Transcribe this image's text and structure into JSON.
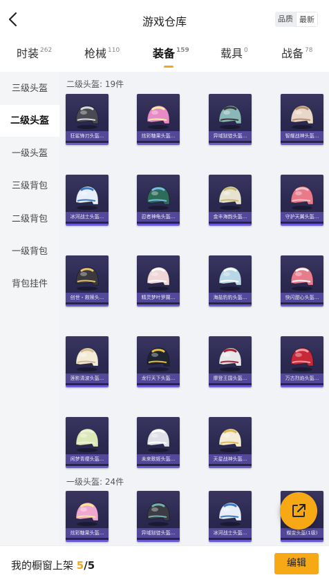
{
  "header": {
    "title": "游戏仓库",
    "sort": [
      "品质",
      "最新"
    ],
    "active_sort": 1
  },
  "tabs": [
    {
      "label": "时装",
      "count": "262"
    },
    {
      "label": "枪械",
      "count": "110"
    },
    {
      "label": "装备",
      "count": "159",
      "active": true
    },
    {
      "label": "载具",
      "count": "0"
    },
    {
      "label": "战备",
      "count": "78"
    }
  ],
  "sidebar": {
    "items": [
      "三级头盔",
      "二级头盔",
      "一级头盔",
      "三级背包",
      "二级背包",
      "一级背包",
      "背包挂件"
    ],
    "active": 1
  },
  "sections": [
    {
      "title": "二级头盔: 19件",
      "items": [
        {
          "name": "狂鲨锋刃头盔...",
          "color": "#4a4a52",
          "accent": "#d8d8e0"
        },
        {
          "name": "炫彩糖果头盔...",
          "color": "#e889c8",
          "accent": "#f4f0a0"
        },
        {
          "name": "异域狱徒头盔...",
          "color": "#8ab8b8",
          "accent": "#3a3a3a"
        },
        {
          "name": "智耀战神头盔...",
          "color": "#e9d7c9",
          "accent": "#b89070"
        },
        {
          "name": "冰河战士头盔...",
          "color": "#e8eef8",
          "accent": "#3a78c8"
        },
        {
          "name": "忍者神龟头盔...",
          "color": "#2e6b58",
          "accent": "#7ab8e8"
        },
        {
          "name": "金丰海韵头盔...",
          "color": "#e6e4d0",
          "accent": "#c8b870"
        },
        {
          "name": "守护天翼头盔...",
          "color": "#e87a8a",
          "accent": "#f0c0c8"
        },
        {
          "name": "创世・救赎头...",
          "color": "#3a3a3e",
          "accent": "#e8c070"
        },
        {
          "name": "精灵梦叶罗蘭...",
          "color": "#f0d6d8",
          "accent": "#ffffff"
        },
        {
          "name": "海盐豹豹头盔...",
          "color": "#b8d8e8",
          "accent": "#ffffff"
        },
        {
          "name": "快闪甜心头盔...",
          "color": "#e67c8c",
          "accent": "#ffffff"
        },
        {
          "name": "莲影清波头盔...",
          "color": "#f2ebd8",
          "accent": "#d8b890"
        },
        {
          "name": "龙行天下头盔...",
          "color": "#1e2430",
          "accent": "#e8c040"
        },
        {
          "name": "摩登王国头盔...",
          "color": "#e8e8ec",
          "accent": "#a82030"
        },
        {
          "name": "万古烈焰头盔...",
          "color": "#c82838",
          "accent": "#f0a0a0"
        },
        {
          "name": "闲梦青缨头盔...",
          "color": "#dce8b8",
          "accent": "#f0f0d8"
        },
        {
          "name": "未来歌姬头盔...",
          "color": "#e0e0e8",
          "accent": "#ffffff"
        },
        {
          "name": "天星战神头盔...",
          "color": "#f2ecd8",
          "accent": "#e0b850"
        }
      ]
    },
    {
      "title": "一级头盔: 24件",
      "items": [
        {
          "name": "炫彩糖果头盔...",
          "color": "#f0a8d0",
          "accent": "#f8e890"
        },
        {
          "name": "异域狱徒头盔...",
          "color": "#3c3c44",
          "accent": "#70b0b0"
        },
        {
          "name": "冰河战士头盔...",
          "color": "#e8eef8",
          "accent": "#3a78c8"
        },
        {
          "name": "蝶变头盔(1级)",
          "color": "#d86a9a",
          "accent": "#f8c0d8"
        }
      ]
    }
  ],
  "footer": {
    "label": "我的橱窗上架",
    "count": "5",
    "total": "/5",
    "edit": "编辑"
  }
}
